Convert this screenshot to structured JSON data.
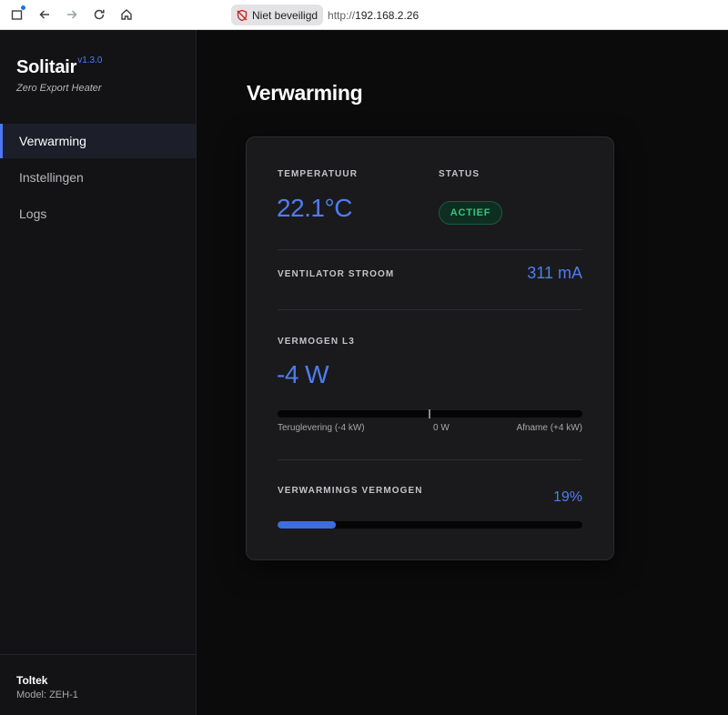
{
  "browser": {
    "security_label": "Niet beveiligd",
    "url_scheme": "http://",
    "url_host": "192.168.2.26",
    "icons": [
      "tab-icon",
      "back-icon",
      "forward-icon",
      "reload-icon",
      "home-icon",
      "not-secure-icon"
    ]
  },
  "sidebar": {
    "brand": "Solitair",
    "version": "v1.3.0",
    "subtitle": "Zero Export Heater",
    "items": [
      {
        "label": "Verwarming",
        "active": true
      },
      {
        "label": "Instellingen",
        "active": false
      },
      {
        "label": "Logs",
        "active": false
      }
    ],
    "footer": {
      "name": "Toltek",
      "model": "Model: ZEH-1"
    }
  },
  "main": {
    "title": "Verwarming",
    "temperature": {
      "label": "TEMPERATUUR",
      "value": "22.1°C"
    },
    "status": {
      "label": "STATUS",
      "value": "ACTIEF"
    },
    "fan_current": {
      "label": "VENTILATOR STROOM",
      "value": "311 mA"
    },
    "power_l3": {
      "label": "VERMOGEN L3",
      "value": "-4 W",
      "scale_left": "Teruglevering (-4 kW)",
      "scale_center": "0 W",
      "scale_right": "Afname (+4 kW)",
      "watts": -4,
      "range_watts": [
        -4000,
        4000
      ]
    },
    "heating_power": {
      "label": "VERWARMINGS VERMOGEN",
      "value": "19%",
      "percent": 19
    }
  },
  "colors": {
    "accent": "#4f7df0",
    "status_green": "#36c47a",
    "background": "#0b0b0c",
    "sidebar_bg": "#131315",
    "card_bg": "#1a1a1c"
  }
}
